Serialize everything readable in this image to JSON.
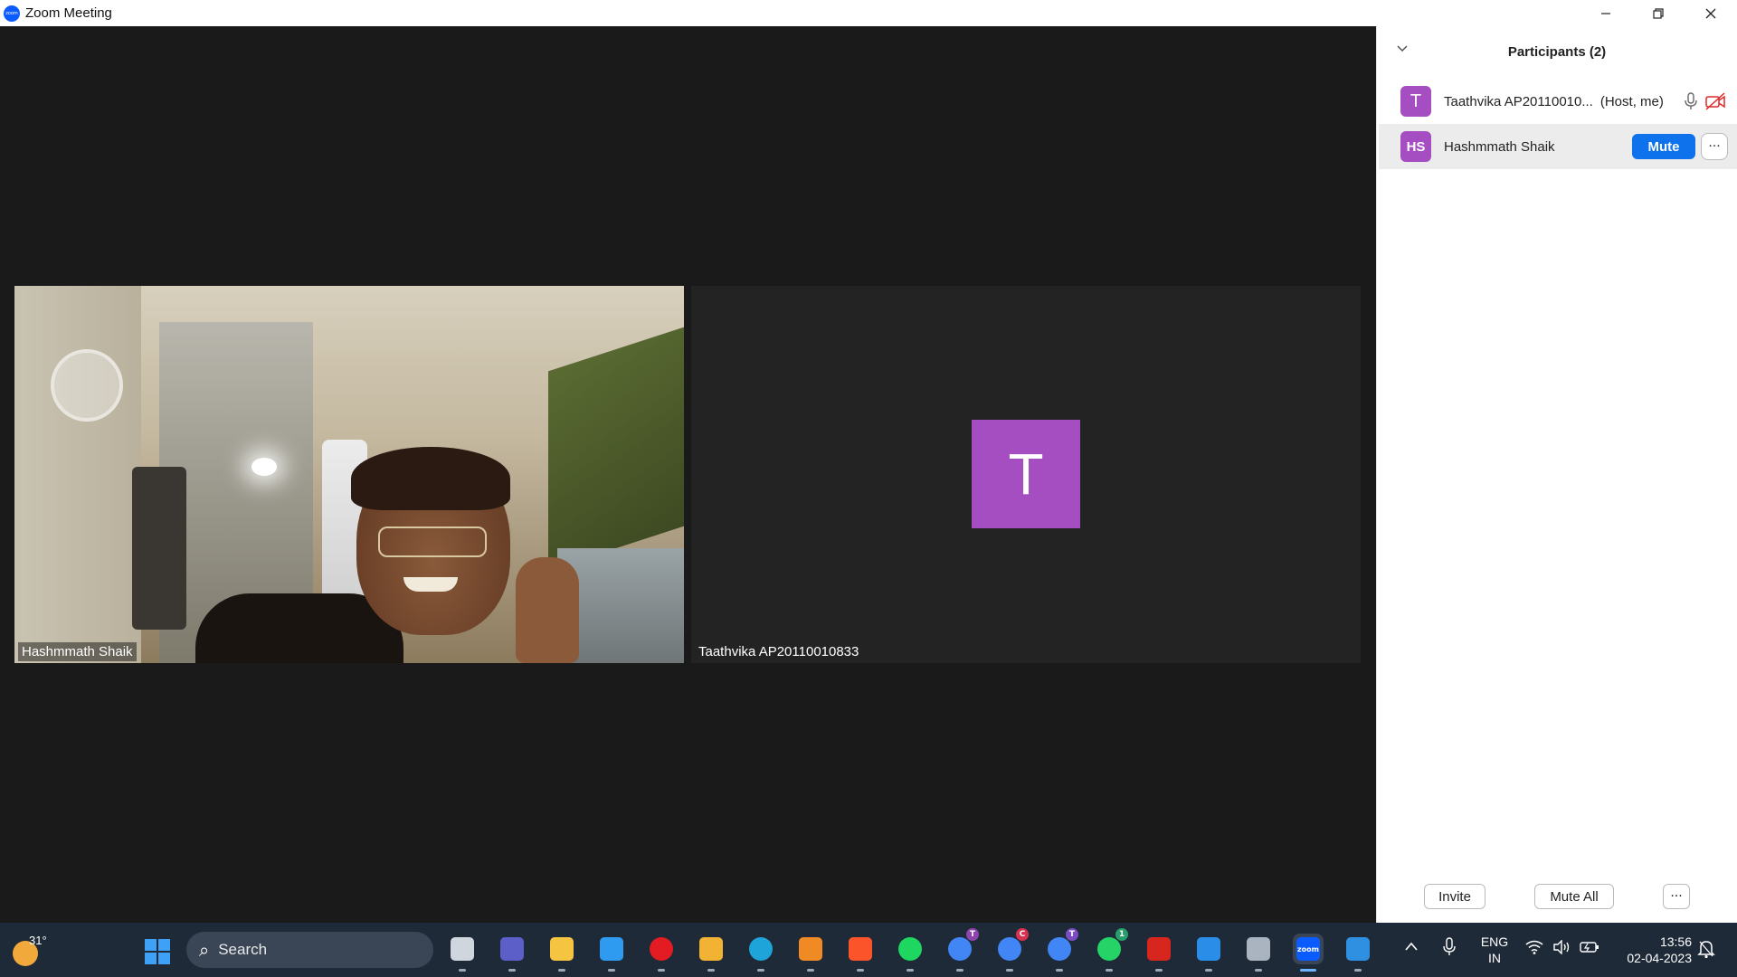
{
  "window": {
    "title": "Zoom Meeting",
    "app_icon_label": "zoom",
    "controls": [
      "minimize-icon",
      "restore-icon",
      "close-icon"
    ]
  },
  "video_tiles": [
    {
      "name": "Hashmmath Shaik",
      "type": "camera"
    },
    {
      "name": "Taathvika AP20110010833",
      "type": "avatar",
      "avatar_letter": "T",
      "avatar_color": "#a44ec2"
    }
  ],
  "participants_panel": {
    "title": "Participants (2)",
    "participants": [
      {
        "initials": "T",
        "name": "Taathvika AP20110010...",
        "tag": "(Host, me)",
        "avatar_color": "#a44ec2",
        "icons": [
          "microphone-icon",
          "video-off-icon"
        ]
      },
      {
        "initials": "HS",
        "name": "Hashmmath Shaik",
        "button": "Mute",
        "more": "···",
        "avatar_color": "#a44ec2"
      }
    ],
    "footer": {
      "invite": "Invite",
      "mute_all": "Mute All",
      "more": "···"
    }
  },
  "taskbar": {
    "weather_temp": "31°",
    "search_placeholder": "Search",
    "apps": [
      {
        "name": "task-view",
        "color": "#cfd6de"
      },
      {
        "name": "teams-chat",
        "color": "#5b5fc7"
      },
      {
        "name": "file-explorer",
        "color": "#f5c542"
      },
      {
        "name": "microsoft-store",
        "color": "#2f9bf0"
      },
      {
        "name": "opera",
        "color": "#e31b23"
      },
      {
        "name": "brave-like-shield",
        "color": "#f2b233"
      },
      {
        "name": "edge",
        "color": "#1ea4d8"
      },
      {
        "name": "brave-alt",
        "color": "#f08a24"
      },
      {
        "name": "brave",
        "color": "#fb542b"
      },
      {
        "name": "spotify",
        "color": "#1ed760"
      },
      {
        "name": "chrome-profile-t",
        "color": "#4285f4",
        "badge": "T",
        "badge_color": "#8e44ad"
      },
      {
        "name": "chrome-profile-c",
        "color": "#4285f4",
        "badge": "C",
        "badge_color": "#d9304f"
      },
      {
        "name": "chrome-profile-t2",
        "color": "#4285f4",
        "badge": "T",
        "badge_color": "#7b4cc2"
      },
      {
        "name": "whatsapp",
        "color": "#25d366",
        "badge": "1",
        "badge_color": "#25a06b"
      },
      {
        "name": "adobe-acrobat",
        "color": "#d7261e"
      },
      {
        "name": "photos",
        "color": "#2a8ee8"
      },
      {
        "name": "settings",
        "color": "#a9b4c0"
      },
      {
        "name": "zoom",
        "color": "#0b5cff",
        "active": true,
        "label": "zoom"
      },
      {
        "name": "vscode",
        "color": "#2f8fe0"
      }
    ],
    "tray": {
      "chevron": "^",
      "lang_line1": "ENG",
      "lang_line2": "IN",
      "time": "13:56",
      "date": "02-04-2023"
    }
  }
}
